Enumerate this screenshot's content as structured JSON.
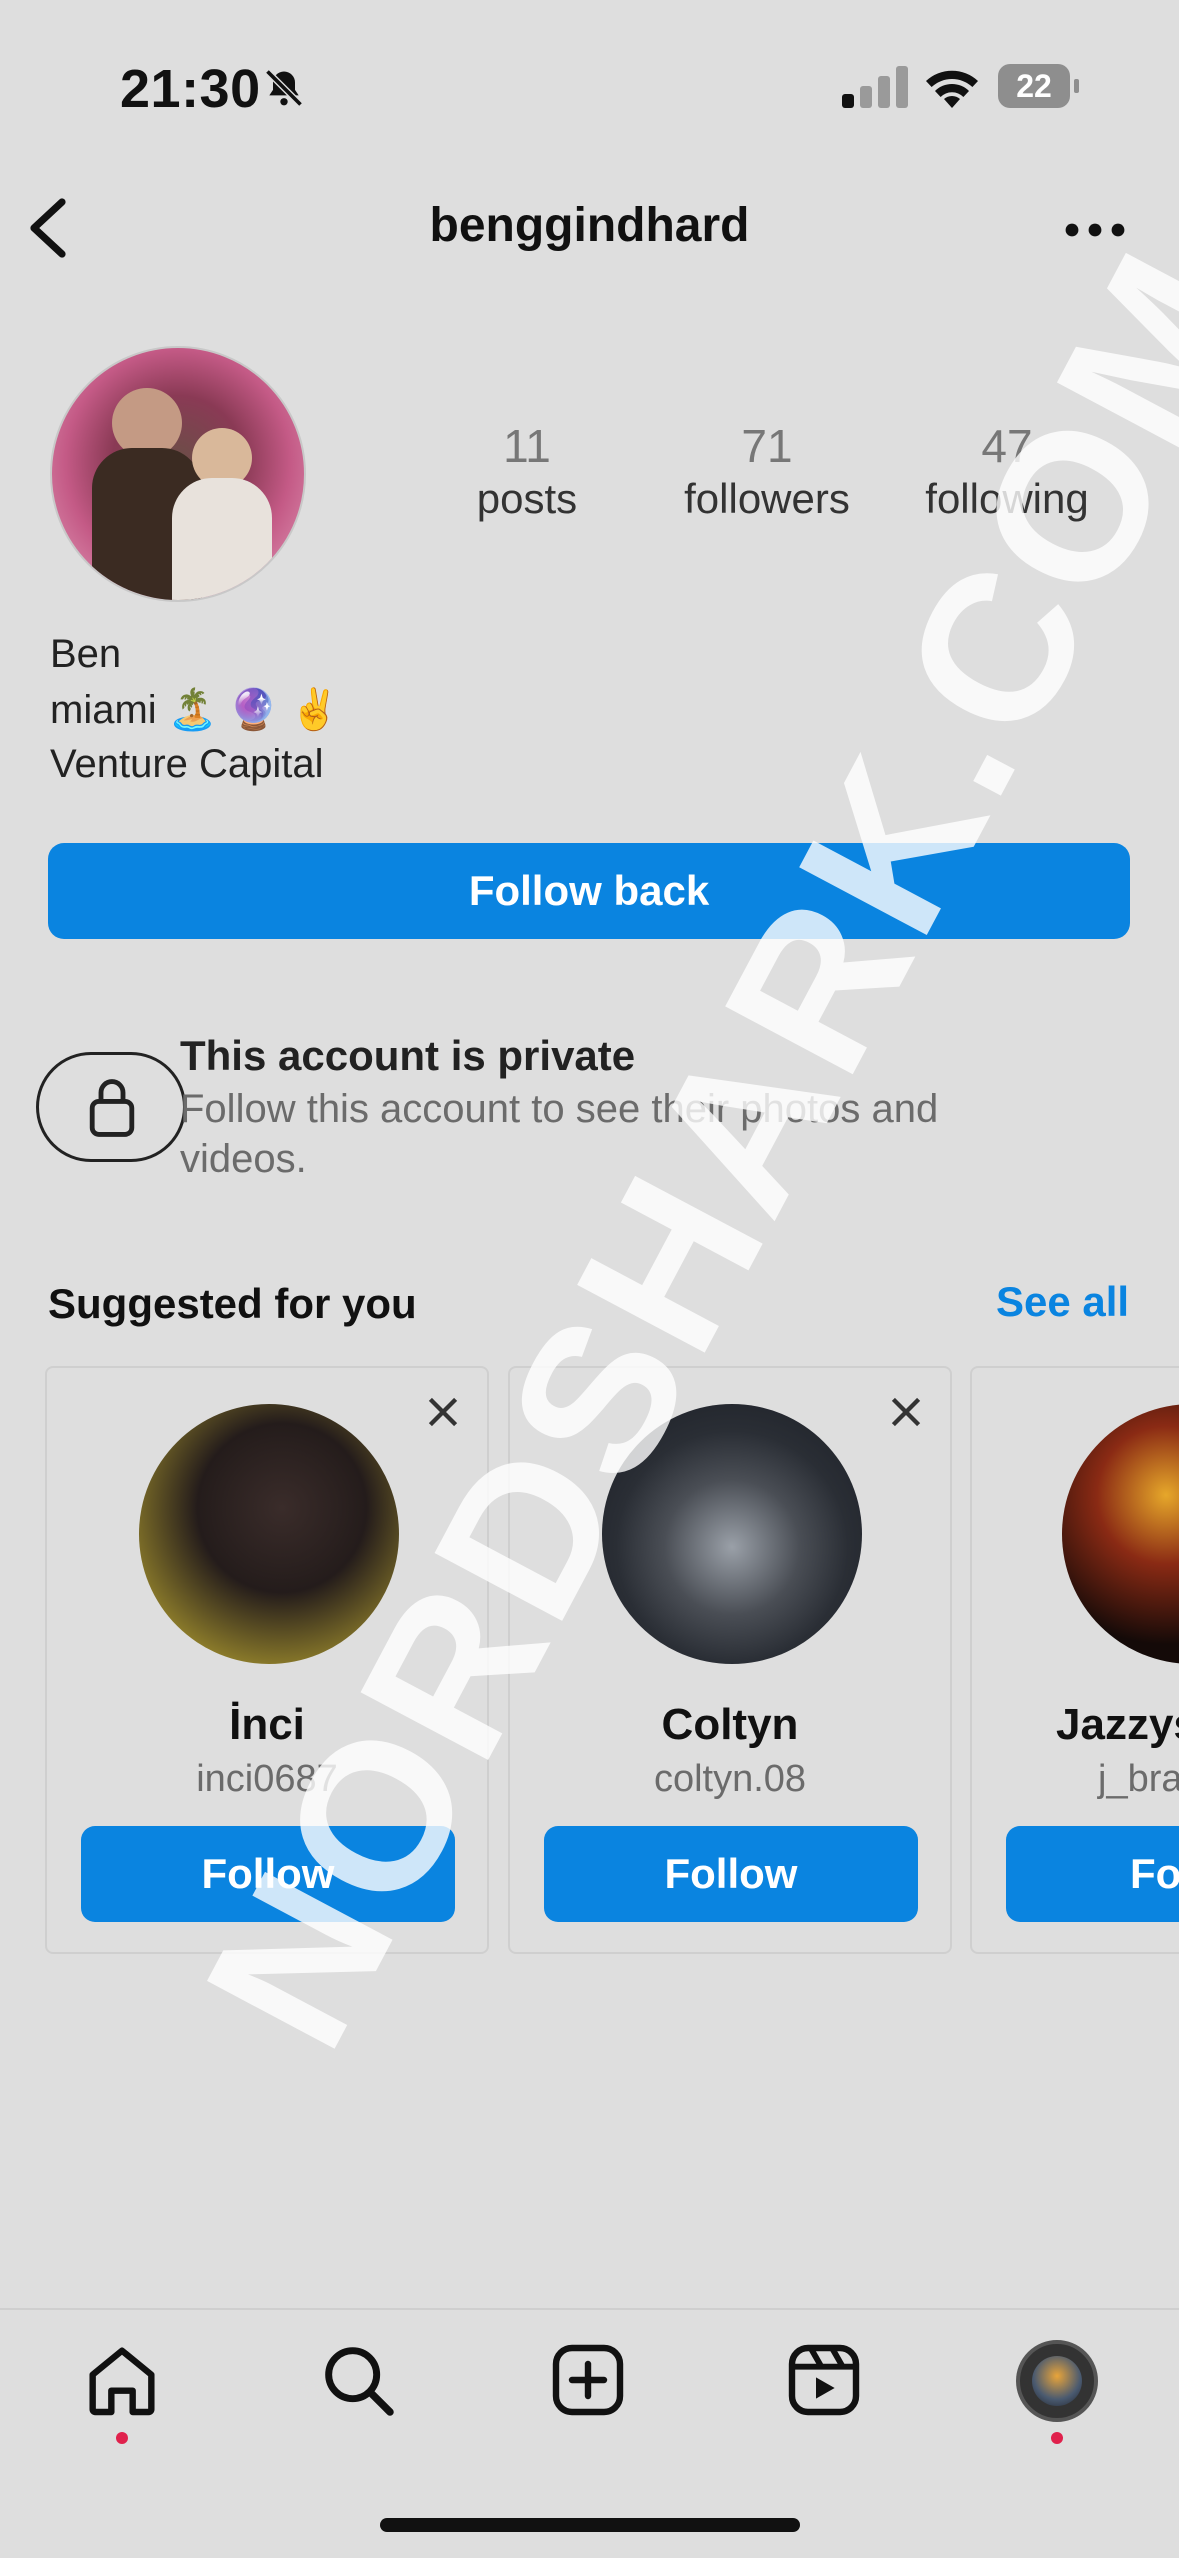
{
  "status_bar": {
    "time": "21:30",
    "battery": "22"
  },
  "header": {
    "username": "benggindhard"
  },
  "profile": {
    "posts_count": "11",
    "posts_label": "posts",
    "followers_count": "71",
    "followers_label": "followers",
    "following_count": "47",
    "following_label": "following",
    "bio_name": "Ben",
    "bio_line2": "miami 🏝️ 🔮 ✌️",
    "bio_line3": "Venture Capital"
  },
  "follow_back_label": "Follow back",
  "private": {
    "title": "This account is private",
    "description": "Follow this account to see their photos and videos."
  },
  "suggested": {
    "title": "Suggested for you",
    "see_all": "See all",
    "cards": [
      {
        "name": "İnci",
        "handle": "inci0687",
        "follow_label": "Follow"
      },
      {
        "name": "Coltyn",
        "handle": "coltyn.08",
        "follow_label": "Follow"
      },
      {
        "name": "Jazzys",
        "handle": "j_bra",
        "follow_label": "Fo"
      }
    ]
  },
  "watermark": "NORDSHARK.COM",
  "colors": {
    "accent": "#0a84e0",
    "background": "#dedede",
    "notification_dot": "#e0214c"
  },
  "icons": [
    "bell-slash-icon",
    "signal-icon",
    "wifi-icon",
    "battery-icon",
    "back-chevron-icon",
    "more-icon",
    "lock-icon",
    "close-icon",
    "home-icon",
    "search-icon",
    "create-icon",
    "reels-icon",
    "profile-avatar-icon"
  ]
}
